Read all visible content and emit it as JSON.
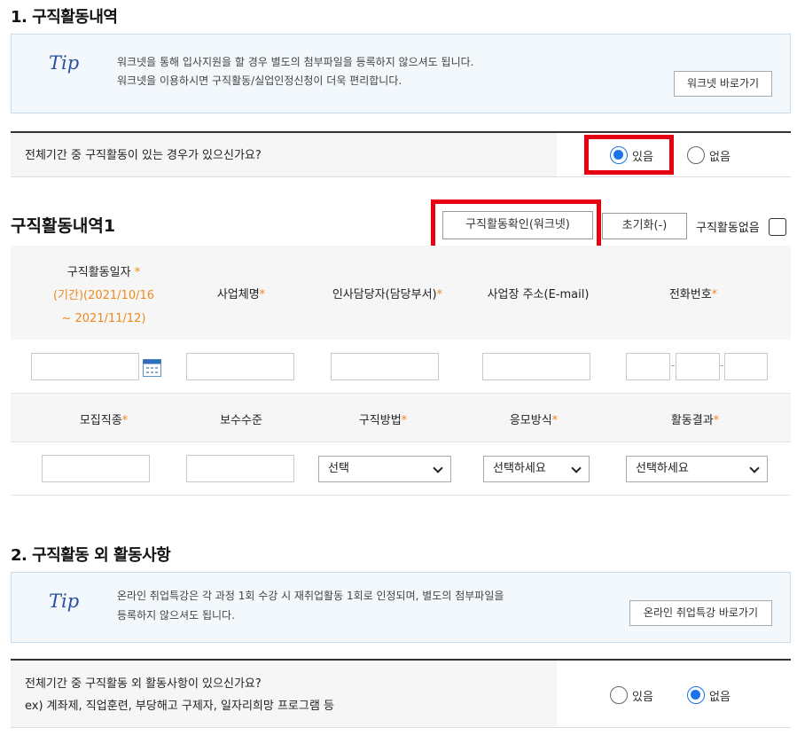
{
  "section1": {
    "title": "1. 구직활동내역",
    "tip_logo": "Tip",
    "tip_line1": "워크넷을 통해 입사지원을 할 경우 별도의 첨부파일을 등록하지 않으셔도 됩니다.",
    "tip_line2": "워크넷을 이용하시면 구직활동/실업인정신청이 더욱 편리합니다.",
    "tip_button": "워크넷 바로가기",
    "question": "전체기간 중 구직활동이 있는 경우가 있으신가요?",
    "radio_yes": "있음",
    "radio_no": "없음",
    "selected": "있음"
  },
  "activity": {
    "title": "구직활동내역1",
    "confirm_button": "구직활동확인(워크넷)",
    "reset_button": "초기화(-)",
    "none_label": "구직활동없음",
    "headers1": {
      "date_label": "구직활동일자",
      "date_range_1": "(기간)(2021/10/16",
      "date_range_2": "~ 2021/11/12)",
      "company": "사업체명",
      "manager": "인사담당자(담당부서)",
      "address": "사업장 주소(E-mail)",
      "phone": "전화번호"
    },
    "headers2": {
      "job": "모집직종",
      "salary": "보수수준",
      "method": "구직방법",
      "apply": "응모방식",
      "result": "활동결과"
    },
    "select_method": "선택",
    "select_apply": "선택하세요",
    "select_result": "선택하세요",
    "star": "*",
    "dash": "-"
  },
  "section2": {
    "title": "2. 구직활동 외 활동사항",
    "tip_logo": "Tip",
    "tip_line1": "온라인 취업특강은 각 과정 1회 수강 시 재취업활동 1회로 인정되며, 별도의 첨부파일을",
    "tip_line2": "등록하지 않으셔도 됩니다.",
    "tip_button": "온라인 취업특강 바로가기",
    "question_line1": "전체기간 중 구직활동 외 활동사항이 있으신가요?",
    "question_line2": "ex) 계좌제, 직업훈련, 부당해고 구제자, 일자리희망 프로그램 등",
    "radio_yes": "있음",
    "radio_no": "없음",
    "selected": "없음"
  },
  "colors": {
    "highlight_red": "#e60012",
    "radio_blue": "#1a73e8",
    "star_orange": "#f08a1c"
  }
}
